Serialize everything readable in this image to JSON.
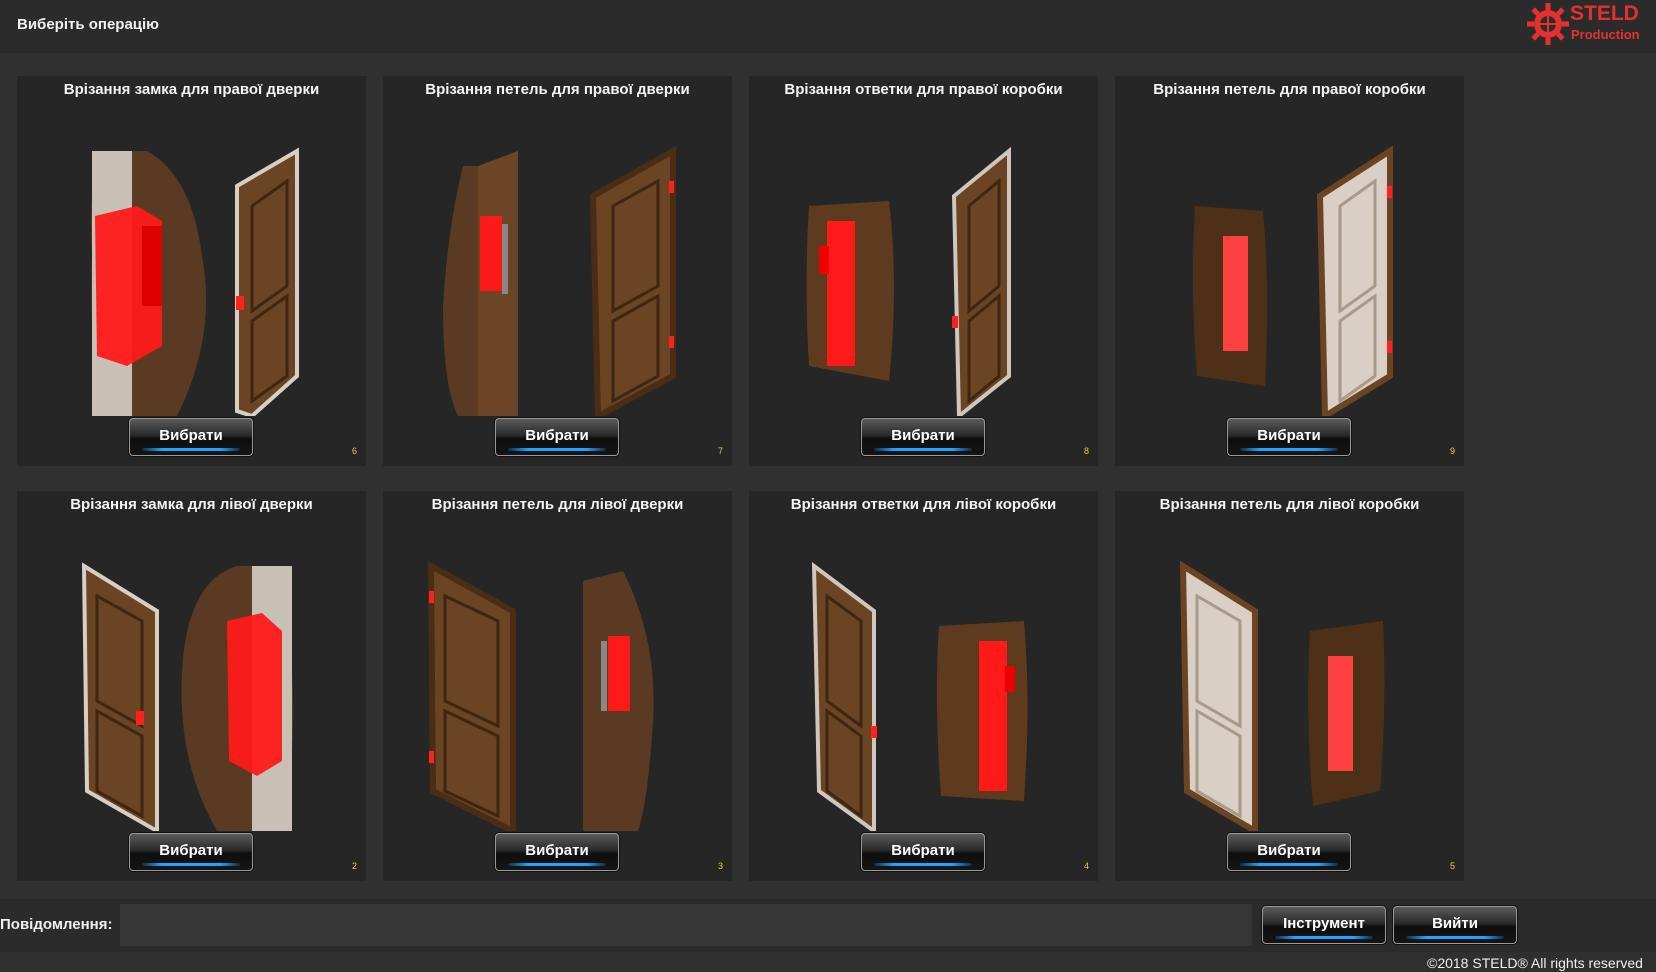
{
  "header": {
    "title": "Виберіть операцію",
    "logo_brand": "STELD",
    "logo_sub": "Production"
  },
  "colors": {
    "accent_red": "#e53030",
    "button_glow": "#1fa3ff",
    "card_bg": "#262626",
    "number_yellow": "#e6d23a"
  },
  "operations": [
    {
      "title": "Врізання замка для правої дверки",
      "button": "Вибрати",
      "number": "6",
      "illustration": "right-door-lock"
    },
    {
      "title": "Врізання петель для правої дверки",
      "button": "Вибрати",
      "number": "7",
      "illustration": "right-door-hinges"
    },
    {
      "title": "Врізання ответки для правої коробки",
      "button": "Вибрати",
      "number": "8",
      "illustration": "right-frame-strike"
    },
    {
      "title": "Врізання петель для правої коробки",
      "button": "Вибрати",
      "number": "9",
      "illustration": "right-frame-hinges"
    },
    {
      "title": "Врізання замка для лівої дверки",
      "button": "Вибрати",
      "number": "2",
      "illustration": "left-door-lock"
    },
    {
      "title": "Врізання петель для лівої дверки",
      "button": "Вибрати",
      "number": "3",
      "illustration": "left-door-hinges"
    },
    {
      "title": "Врізання ответки для лівої коробки",
      "button": "Вибрати",
      "number": "4",
      "illustration": "left-frame-strike"
    },
    {
      "title": "Врізання петель для лівої коробки",
      "button": "Вибрати",
      "number": "5",
      "illustration": "left-frame-hinges"
    }
  ],
  "footer_bar": {
    "message_label": "Повідомлення:",
    "message_value": "",
    "tool_button": "Інструмент",
    "exit_button": "Вийти"
  },
  "copyright": "©2018 STELD® All rights reserved"
}
